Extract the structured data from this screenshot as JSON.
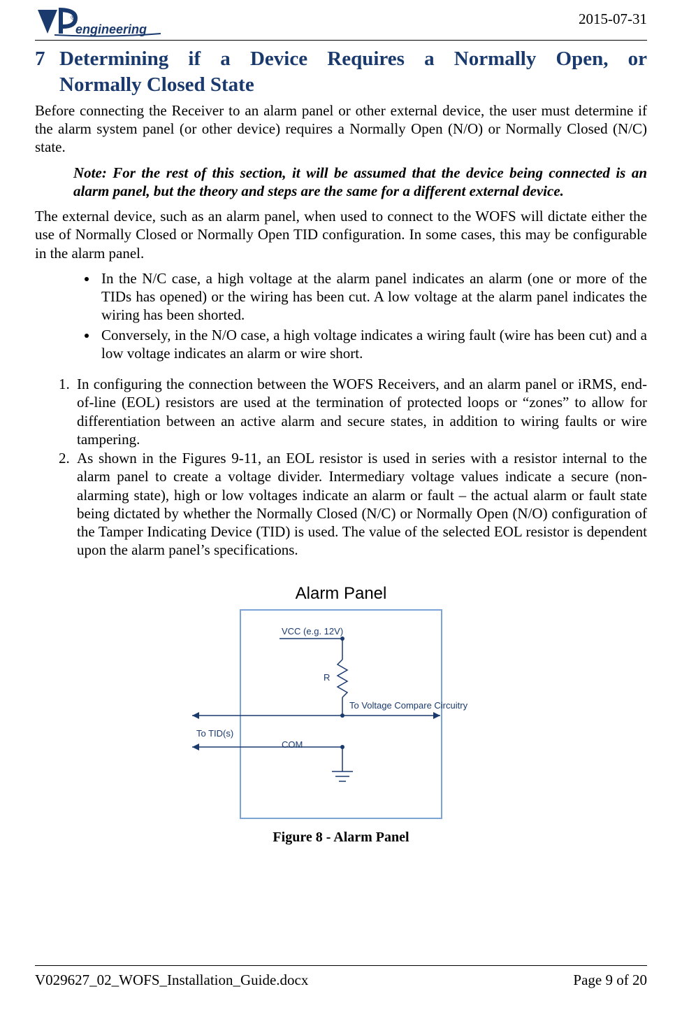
{
  "header": {
    "date": "2015-07-31",
    "logo_text": "VP engineering"
  },
  "section": {
    "number": "7",
    "title_line1": "Determining if a Device Requires a Normally Open, or",
    "title_line2": "Normally Closed State"
  },
  "para1": "Before connecting the Receiver to an alarm panel or other external device, the user must determine if the alarm system panel (or other device) requires a Normally Open (N/O) or Normally Closed (N/C) state.",
  "note": "Note: For the rest of this section, it will be assumed that the device being connected is an alarm panel, but the theory and steps are the same for a different external device.",
  "para2": "The external device, such as an alarm panel, when used to connect to the WOFS will dictate either the use of Normally Closed or Normally Open TID configuration. In some cases, this may be configurable in the alarm panel.",
  "bullets": [
    "In the N/C case, a high voltage at the alarm panel indicates an alarm (one or more of the TIDs has opened) or the wiring has been cut. A low voltage at the alarm panel indicates the wiring has been shorted.",
    "Conversely, in the N/O case, a high voltage indicates a wiring fault (wire has been cut) and a low voltage indicates an alarm or wire short."
  ],
  "numbered": [
    "In configuring the connection between the WOFS Receivers, and an alarm panel or iRMS, end-of-line (EOL) resistors are used at the termination of protected loops or “zones” to allow for differentiation between an active alarm and secure states, in addition to wiring faults or wire tampering.",
    "As shown in the Figures 9-11, an EOL resistor is used in series with a resistor internal to the alarm panel to create a voltage divider. Intermediary voltage values indicate a secure (non-alarming state), high or low voltages indicate an alarm or fault – the actual alarm or fault state being dictated by whether the Normally Closed (N/C) or Normally Open (N/O) configuration of the Tamper Indicating Device (TID) is used.  The value of the selected EOL resistor is dependent upon the alarm panel’s specifications."
  ],
  "figure": {
    "title": "Alarm Panel",
    "vcc_label": "VCC (e.g. 12V)",
    "r_label": "R",
    "compare_label": "To Voltage Compare Circuitry",
    "tid_label": "To TID(s)",
    "com_label": "COM",
    "caption": "Figure 8 - Alarm Panel"
  },
  "footer": {
    "filename": "V029627_02_WOFS_Installation_Guide.docx",
    "page": "Page 9 of 20"
  }
}
